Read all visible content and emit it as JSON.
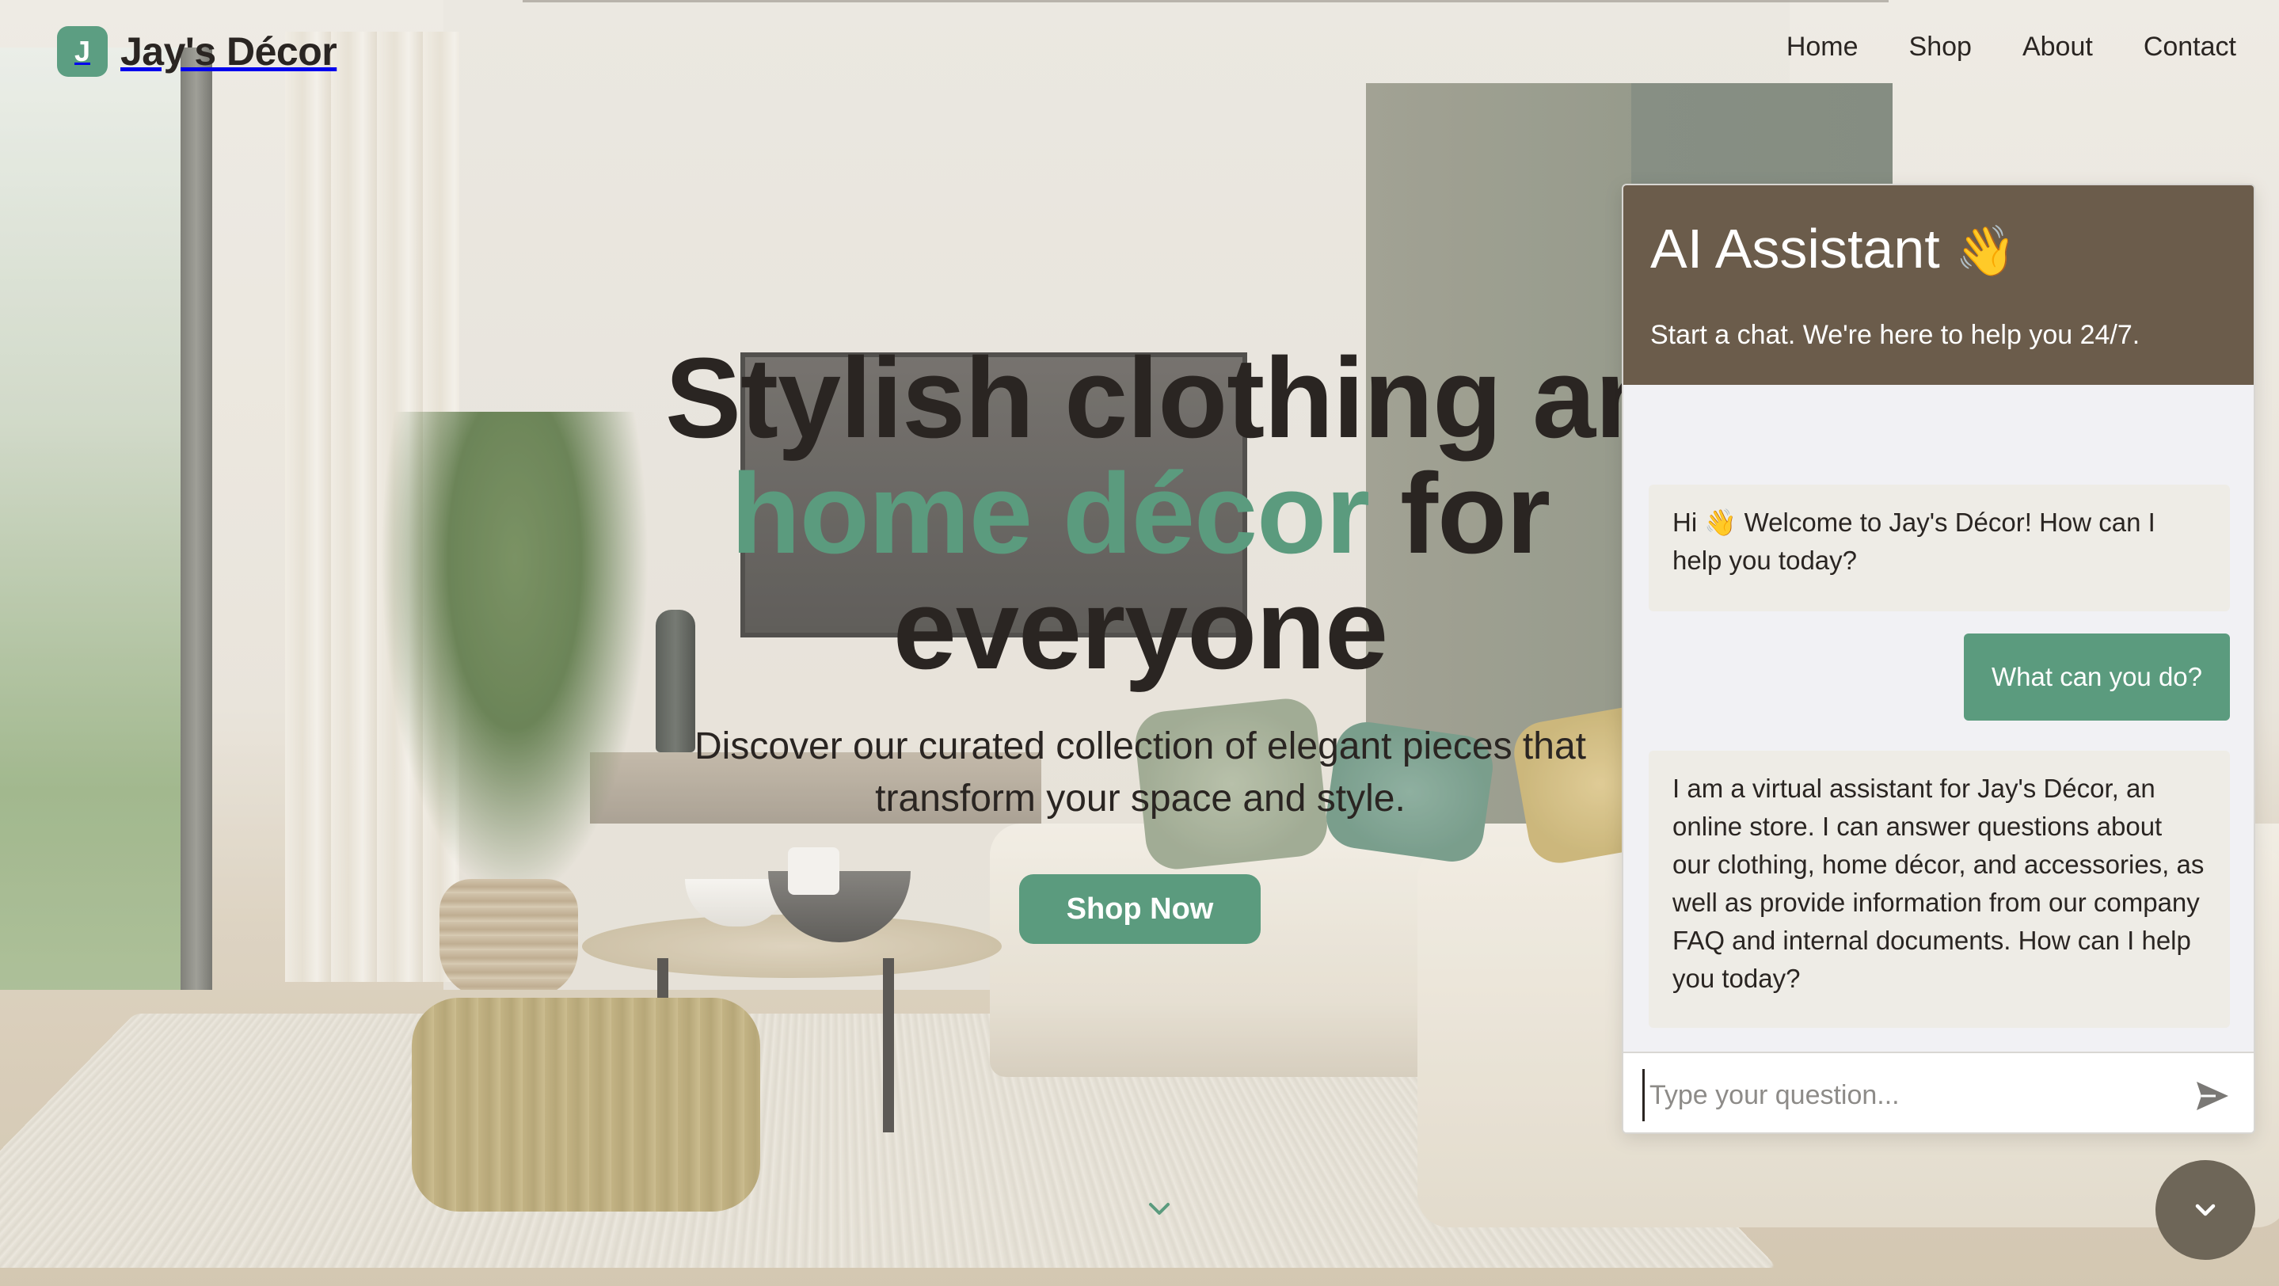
{
  "brand": {
    "logo_letter": "J",
    "name": "Jay's Décor",
    "accent_color": "#5b9b7e",
    "chat_header_color": "#6b5c4b"
  },
  "nav": {
    "items": [
      {
        "label": "Home"
      },
      {
        "label": "Shop"
      },
      {
        "label": "About"
      },
      {
        "label": "Contact"
      }
    ]
  },
  "hero": {
    "title_line1": "Stylish clothing an",
    "title_accent": "home décor",
    "title_line2_rest": " for",
    "title_line3": "everyone",
    "subtitle": "Discover our curated collection of elegant pieces that transform your space and style.",
    "cta_label": "Shop Now",
    "scroll_icon": "chevron-down-icon"
  },
  "chat": {
    "title": "AI Assistant",
    "title_emoji": "👋",
    "subtitle": "Start a chat. We're here to help you 24/7.",
    "messages": [
      {
        "role": "assistant",
        "text": "Hi 👋 Welcome to Jay's Décor! How can I help you today?"
      },
      {
        "role": "user",
        "text": "What can you do?"
      },
      {
        "role": "assistant",
        "text": "I am a virtual assistant for Jay's Décor, an online store. I can answer questions about our clothing, home décor, and accessories, as well as provide information from our company FAQ and internal documents. How can I help you today?"
      }
    ],
    "input_placeholder": "Type your question...",
    "send_icon": "send-icon",
    "toggle_icon": "chevron-down-icon"
  }
}
